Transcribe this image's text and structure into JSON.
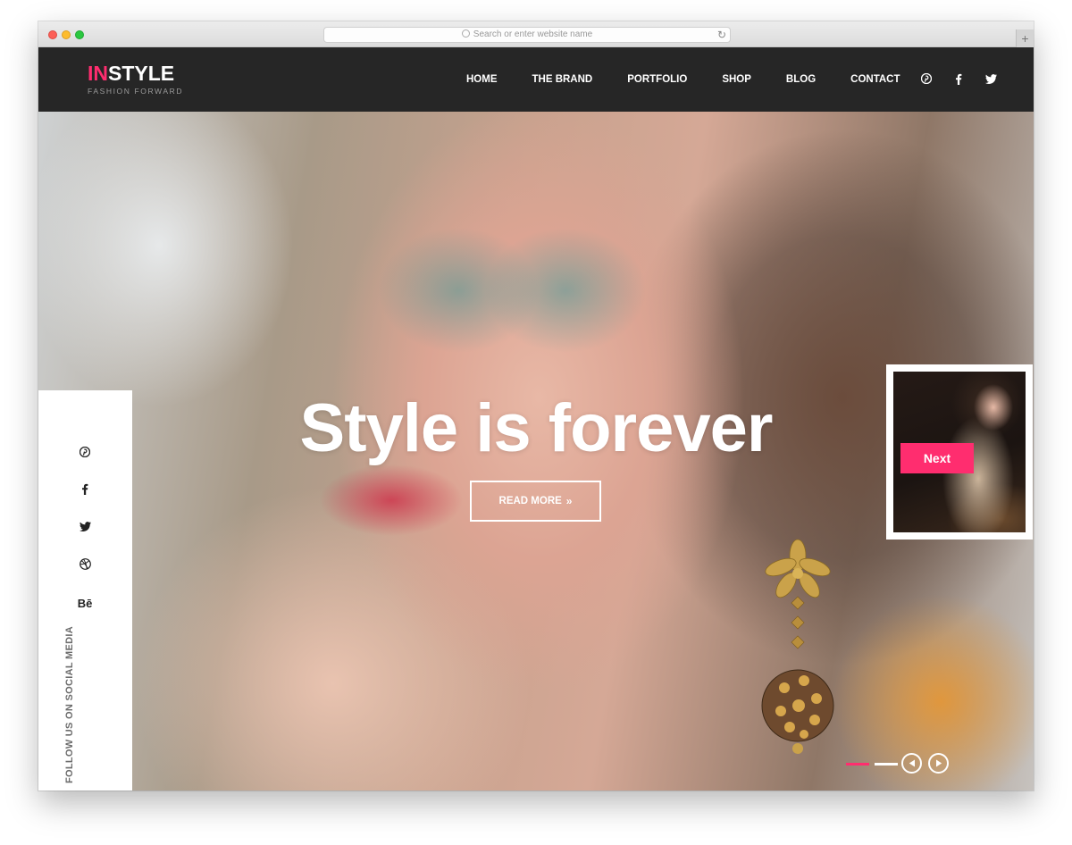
{
  "browser": {
    "address_placeholder": "Search or enter website name",
    "reload_icon": "reload-icon",
    "new_tab_label": "+"
  },
  "header": {
    "logo_accent": "IN",
    "logo_rest": "STYLE",
    "tagline": "FASHION FORWARD",
    "nav": [
      {
        "label": "HOME"
      },
      {
        "label": "THE BRAND"
      },
      {
        "label": "PORTFOLIO"
      },
      {
        "label": "SHOP"
      },
      {
        "label": "BLOG"
      },
      {
        "label": "CONTACT"
      }
    ],
    "social_icons": [
      "pinterest-icon",
      "facebook-icon",
      "twitter-icon"
    ]
  },
  "hero": {
    "title": "Style is forever",
    "button_label": "READ MORE",
    "button_icon": "double-chevron-right-icon",
    "next_label": "Next"
  },
  "sidebar": {
    "icons": [
      "pinterest-icon",
      "facebook-icon",
      "twitter-icon",
      "dribbble-icon",
      "behance-icon"
    ],
    "behance_text": "Bē",
    "follow_text": "FOLLOW US ON SOCIAL MEDIA"
  },
  "slider": {
    "active_index": 1,
    "total_slides": 2
  },
  "colors": {
    "accent": "#ff2d6f",
    "header_bg": "#262626",
    "nav_text": "#ffffff"
  }
}
